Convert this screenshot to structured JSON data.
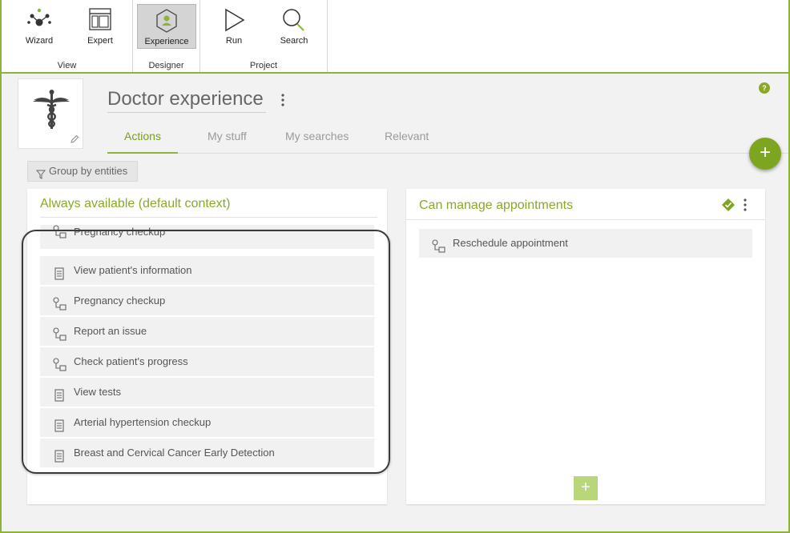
{
  "ribbon": {
    "groups": [
      {
        "label": "View"
      },
      {
        "label": "Designer"
      },
      {
        "label": "Project"
      }
    ],
    "buttons": {
      "wizard": "Wizard",
      "expert": "Expert",
      "experience": "Experience",
      "run": "Run",
      "search": "Search"
    }
  },
  "header": {
    "title": "Doctor experience",
    "help": "?"
  },
  "tabs": [
    "Actions",
    "My stuff",
    "My searches",
    "Relevant"
  ],
  "toolbar": {
    "group_by": "Group by entities",
    "add": "+"
  },
  "panels": {
    "left": {
      "title": "Always available (default context)",
      "items": [
        {
          "label": "Pregnancy checkup",
          "icon": "process-icon"
        },
        {
          "label": "View patient's information",
          "icon": "document-icon"
        },
        {
          "label": "Pregnancy checkup",
          "icon": "process-icon"
        },
        {
          "label": "Report an issue",
          "icon": "process-icon"
        },
        {
          "label": "Check patient's progress",
          "icon": "process-icon"
        },
        {
          "label": "View tests",
          "icon": "document-icon"
        },
        {
          "label": "Arterial hypertension checkup",
          "icon": "document-icon"
        },
        {
          "label": "Breast and Cervical Cancer Early Detection",
          "icon": "document-icon"
        }
      ]
    },
    "right": {
      "title": "Can manage appointments",
      "items": [
        {
          "label": "Reschedule appointment",
          "icon": "process-icon"
        }
      ],
      "add": "+"
    }
  },
  "colors": {
    "accent": "#8db33a",
    "title_green": "#8aa82a"
  }
}
